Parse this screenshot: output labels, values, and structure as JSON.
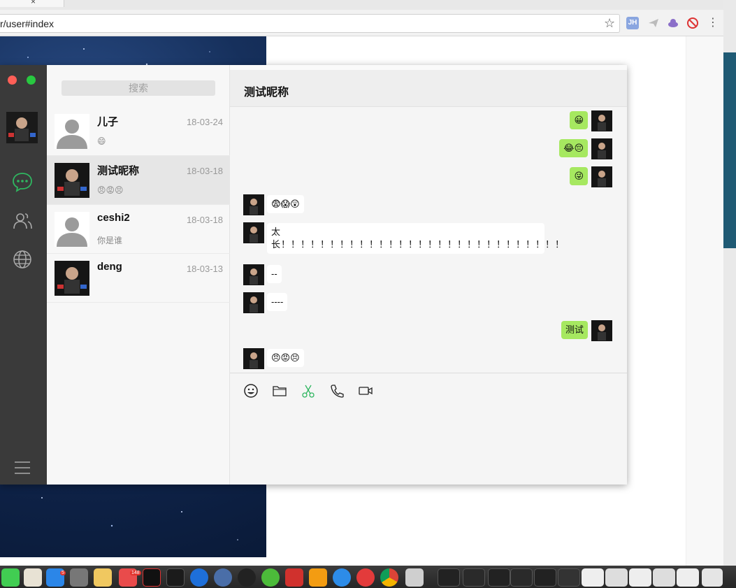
{
  "browser": {
    "url": "r/user#index",
    "extensions": [
      "JH",
      "plane-icon",
      "cloud-icon",
      "block-icon"
    ]
  },
  "app": {
    "search_placeholder": "搜索",
    "sessions": [
      {
        "name": "儿子",
        "time": "18-03-24",
        "preview": "😄",
        "avatar": "default"
      },
      {
        "name": "测试昵称",
        "time": "18-03-18",
        "preview": "😠😡😣",
        "avatar": "photo"
      },
      {
        "name": "ceshi2",
        "time": "18-03-18",
        "preview": "你是谁",
        "avatar": "default"
      },
      {
        "name": "deng",
        "time": "18-03-13",
        "preview": "",
        "avatar": "photo"
      }
    ],
    "chat_title": "测试昵称",
    "messages": [
      {
        "side": "me",
        "text": "😀"
      },
      {
        "side": "me",
        "text": "😂😔"
      },
      {
        "side": "me",
        "text": "😜"
      },
      {
        "side": "other",
        "text": "😨😱😲"
      },
      {
        "side": "other",
        "text": "太长！！！！！！！！！！！！！！！！！！！！！！！！！！！！！"
      },
      {
        "side": "other",
        "text": "--"
      },
      {
        "side": "other",
        "text": "----"
      },
      {
        "side": "me",
        "text": "测试"
      },
      {
        "side": "other",
        "text": "😠😡😣"
      }
    ],
    "toolbar": [
      "emoji-icon",
      "folder-icon",
      "scissors-icon",
      "phone-icon",
      "video-icon"
    ]
  },
  "colors": {
    "sidebar": "#3a3a3a",
    "accent": "#2fb660",
    "my_bubble": "#a6e860",
    "close": "#ff5f57",
    "zoom": "#28c840"
  },
  "dock": {
    "badges": [
      "5",
      "148"
    ]
  }
}
